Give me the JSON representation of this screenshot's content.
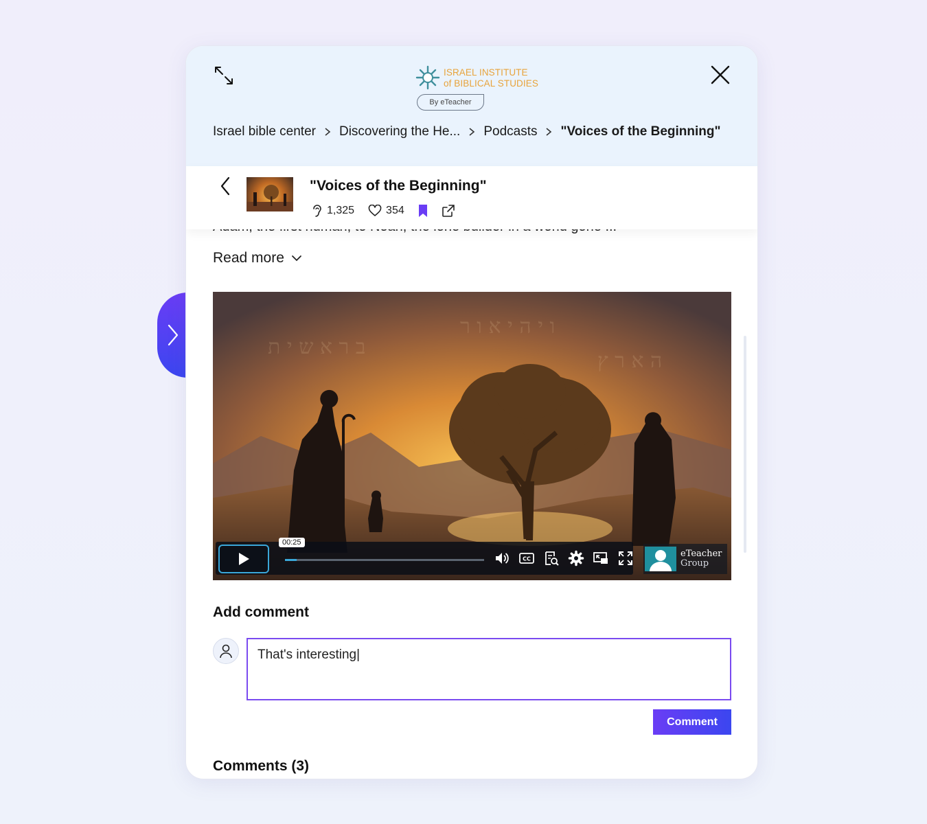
{
  "logo": {
    "line1": "ISRAEL INSTITUTE",
    "line2": "of BIBLICAL STUDIES",
    "by": "By eTeacher"
  },
  "breadcrumb": [
    "Israel bible center",
    "Discovering the He...",
    "Podcasts",
    "\"Voices of the Beginning\""
  ],
  "episode": {
    "title": "\"Voices of the Beginning\"",
    "listens": "1,325",
    "likes": "354"
  },
  "description_clip": "Adam, the first human, to Noah, the lone builder in a world gone ...",
  "read_more": "Read more",
  "player": {
    "time": "00:25",
    "progress": 0.06,
    "brand_line1": "eTeacher",
    "brand_line2": "Group"
  },
  "comment": {
    "heading": "Add comment",
    "value": "That's interesting|",
    "button": "Comment",
    "list_heading": "Comments (3)"
  },
  "colors": {
    "accent": "#6a3df5",
    "accent2": "#3b46f0",
    "header_bg": "#eaf3fd",
    "logo_gold": "#e8a33a"
  }
}
